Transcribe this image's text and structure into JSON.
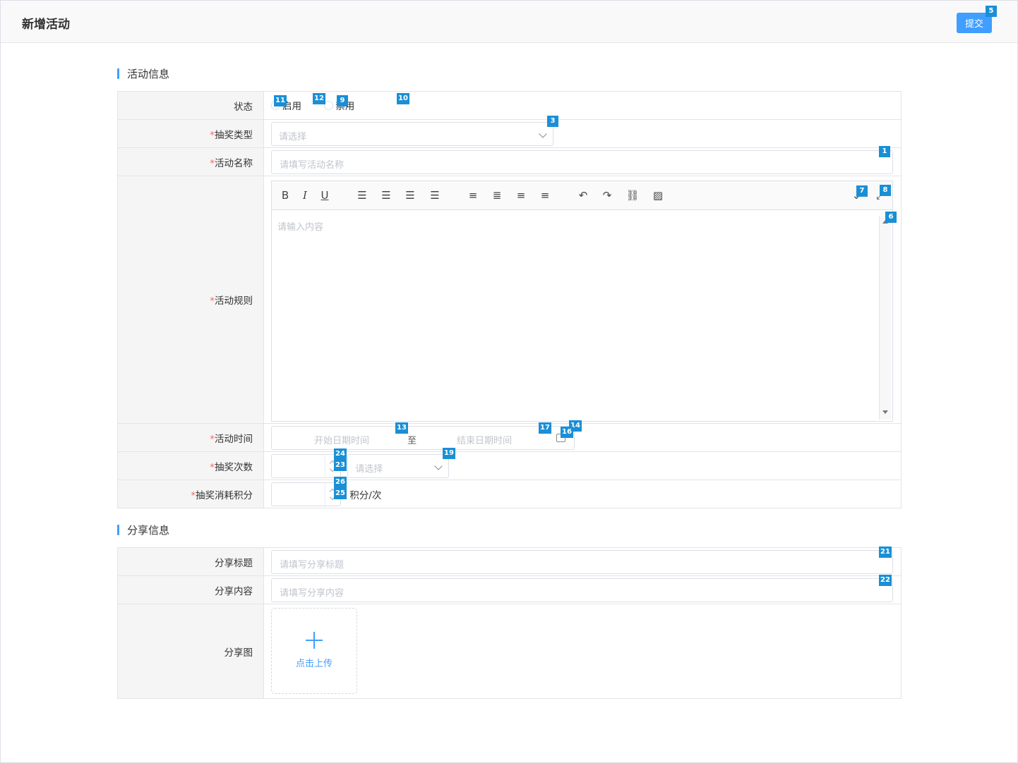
{
  "header": {
    "title": "新增活动",
    "submit_label": "提交"
  },
  "section_activity": {
    "title": "活动信息",
    "status_label": "状态",
    "status_options": [
      "启用",
      "禁用"
    ],
    "lottery_type_label": "抽奖类型",
    "lottery_type_placeholder": "请选择",
    "activity_name_label": "活动名称",
    "activity_name_placeholder": "请填写活动名称",
    "rules_label": "活动规则",
    "rules_placeholder": "请输入内容",
    "time_label": "活动时间",
    "time_start_placeholder": "开始日期时间",
    "time_separator": "至",
    "time_end_placeholder": "结束日期时间",
    "draw_count_label": "抽奖次数",
    "draw_count_period_placeholder": "请选择",
    "cost_points_label": "抽奖消耗积分",
    "cost_points_unit": "积分/次",
    "required_mark": "*"
  },
  "section_share": {
    "title": "分享信息",
    "share_title_label": "分享标题",
    "share_title_placeholder": "请填写分享标题",
    "share_content_label": "分享内容",
    "share_content_placeholder": "请填写分享内容",
    "share_image_label": "分享图",
    "upload_label": "点击上传"
  },
  "editor_toolbar": [
    "bold-icon",
    "italic-icon",
    "underline-icon",
    "bullet-list-icon",
    "numbered-list-icon",
    "outdent-icon",
    "indent-icon",
    "align-center-icon",
    "align-justify-icon",
    "align-left-icon",
    "align-right-icon",
    "undo-icon",
    "redo-icon",
    "link-icon",
    "image-icon",
    "dropdown-icon",
    "fullscreen-icon"
  ],
  "badges": {
    "b1": "1",
    "b3": "3",
    "b5": "5",
    "b6": "6",
    "b7": "7",
    "b8": "8",
    "b9": "9",
    "b10": "10",
    "b11": "11",
    "b12": "12",
    "b13": "13",
    "b14": "14",
    "b16": "16",
    "b17": "17",
    "b19": "19",
    "b21": "21",
    "b22": "22",
    "b23": "23",
    "b24": "24",
    "b25": "25",
    "b26": "26"
  },
  "colors": {
    "primary": "#409eff",
    "required": "#f56c6c",
    "badge": "#1a8fd6"
  }
}
